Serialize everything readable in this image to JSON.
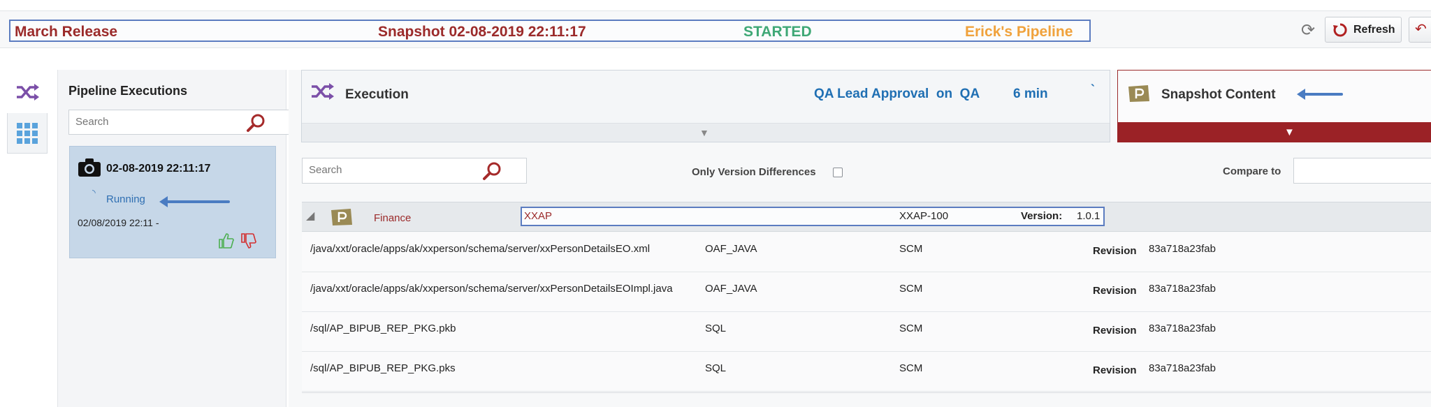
{
  "header": {
    "release": "March Release",
    "snapshot": "Snapshot 02-08-2019 22:11:17",
    "status": "STARTED",
    "pipeline": "Erick's Pipeline",
    "refresh_label": "Refresh",
    "colors": {
      "release": "#9b2a2a",
      "status": "#3fa876",
      "pipeline": "#f0a23c"
    }
  },
  "left_tabs": [
    {
      "icon": "shuffle-icon",
      "selected": true
    },
    {
      "icon": "grid-icon",
      "selected": false
    }
  ],
  "executions_panel": {
    "title": "Pipeline Executions",
    "search_placeholder": "Search",
    "card": {
      "date": "02-08-2019 22:11:17",
      "status": "Running",
      "timestamp": "02/08/2019 22:11  -"
    }
  },
  "execution": {
    "label": "Execution",
    "stage": "QA Lead Approval  on  QA",
    "duration": "6 min",
    "tick": "`"
  },
  "snapshot_content": {
    "label": "Snapshot Content",
    "accent": "#9b2226"
  },
  "filters": {
    "search_placeholder": "Search",
    "only_version_diff_label": "Only Version Differences",
    "only_version_diff_checked": false,
    "compare_label": "Compare to",
    "compare_value": ""
  },
  "group": {
    "name": "Finance",
    "application": "XXAP",
    "code": "XXAP-100",
    "version_label": "Version:",
    "version": "1.0.1"
  },
  "rows": [
    {
      "path": "/java/xxt/oracle/apps/ak/xxperson/schema/server/xxPersonDetailsEO.xml",
      "type": "OAF_JAVA",
      "source": "SCM",
      "revision_label": "Revision",
      "revision": "83a718a23fab"
    },
    {
      "path": "/java/xxt/oracle/apps/ak/xxperson/schema/server/xxPersonDetailsEOImpl.java",
      "type": "OAF_JAVA",
      "source": "SCM",
      "revision_label": "Revision",
      "revision": "83a718a23fab"
    },
    {
      "path": "/sql/AP_BIPUB_REP_PKG.pkb",
      "type": "SQL",
      "source": "SCM",
      "revision_label": "Revision",
      "revision": "83a718a23fab"
    },
    {
      "path": "/sql/AP_BIPUB_REP_PKG.pks",
      "type": "SQL",
      "source": "SCM",
      "revision_label": "Revision",
      "revision": "83a718a23fab"
    }
  ]
}
